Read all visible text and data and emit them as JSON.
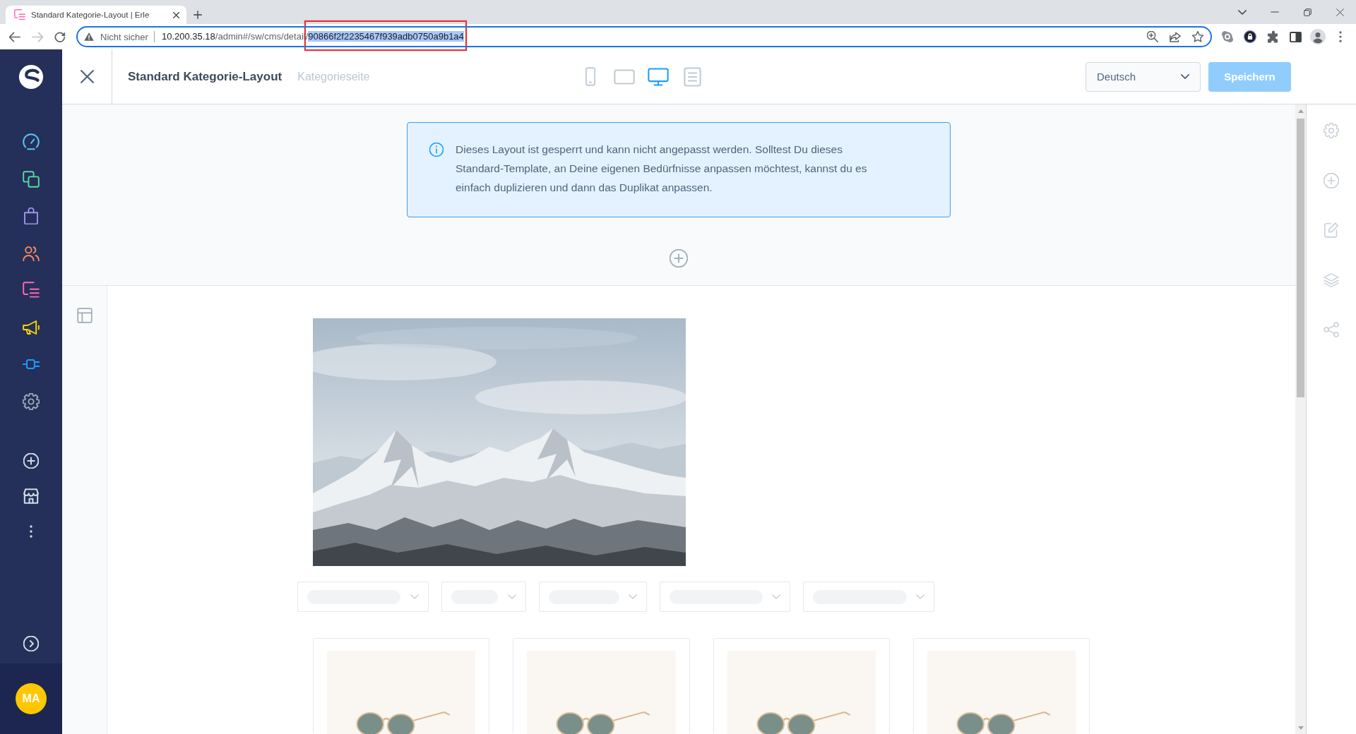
{
  "browser": {
    "tabs": [
      {
        "title": "Standard Kategorie-Layout | Erle",
        "selected": true
      }
    ],
    "nav_buttons": [
      {
        "kind": "back",
        "disabled": false
      },
      {
        "kind": "forward",
        "disabled": true
      },
      {
        "kind": "reload",
        "disabled": false
      }
    ],
    "address_bar": {
      "security_label": "Nicht sicher",
      "url_parts": [
        {
          "text": "10.200.35.18",
          "kind": "host",
          "selected": false
        },
        {
          "text": "/admin#/sw/cms/detail/",
          "kind": "path",
          "selected": false
        },
        {
          "text": "90866f2f2235467f939adb0750a9b1a4",
          "kind": "path",
          "selected": true
        }
      ]
    }
  },
  "sidebar": {
    "items": [
      {
        "kind": "dashboard",
        "color": "#57c7f5"
      },
      {
        "kind": "catalogues",
        "color": "#57d9a3"
      },
      {
        "kind": "orders",
        "color": "#a092f0"
      },
      {
        "kind": "customers",
        "color": "#f88962"
      },
      {
        "kind": "content",
        "color": "#ff68b4"
      },
      {
        "kind": "marketing",
        "color": "#ffd700"
      },
      {
        "kind": "extensions",
        "color": "#189eff"
      },
      {
        "kind": "settings",
        "color": "#9aa8b5"
      }
    ],
    "user": {
      "initials": "MA"
    }
  },
  "header": {
    "title": "Standard Kategorie-Layout",
    "subtitle": "Kategorieseite",
    "device_toggles": [
      {
        "kind": "mobile",
        "selected": false
      },
      {
        "kind": "tablet",
        "selected": false
      },
      {
        "kind": "desktop",
        "selected": true
      },
      {
        "kind": "form",
        "selected": false
      }
    ],
    "language_select": {
      "value": "Deutsch"
    },
    "save_button": {
      "label": "Speichern",
      "disabled": true
    }
  },
  "notice": {
    "text": "Dieses Layout ist gesperrt und kann nicht angepasst werden. Solltest Du dieses Standard-Template, an Deine eigenen Bedürfnisse anpassen möchtest, kannst du es einfach duplizieren und dann das Duplikat anpassen."
  },
  "inspector_sidebar": {
    "items": [
      {
        "kind": "settings",
        "disabled": true
      },
      {
        "kind": "add",
        "disabled": true
      },
      {
        "kind": "edit",
        "disabled": true
      },
      {
        "kind": "layers",
        "disabled": true
      },
      {
        "kind": "share",
        "disabled": true
      }
    ]
  }
}
